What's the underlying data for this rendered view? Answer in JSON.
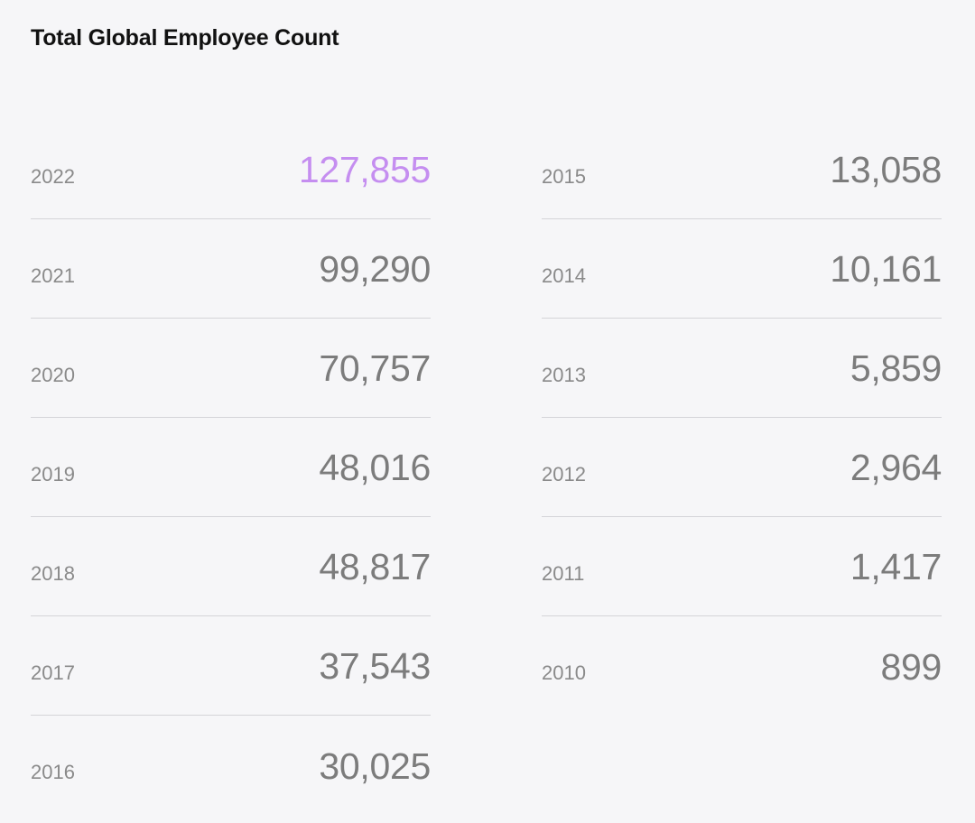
{
  "chart_data": {
    "type": "table",
    "title": "Total Global Employee Count",
    "highlight_color": "#c58ef0",
    "rows": [
      {
        "year": "2022",
        "value": "127,855",
        "highlight": true
      },
      {
        "year": "2021",
        "value": "99,290"
      },
      {
        "year": "2020",
        "value": "70,757"
      },
      {
        "year": "2019",
        "value": "48,016"
      },
      {
        "year": "2018",
        "value": "48,817"
      },
      {
        "year": "2017",
        "value": "37,543"
      },
      {
        "year": "2016",
        "value": "30,025"
      },
      {
        "year": "2015",
        "value": "13,058"
      },
      {
        "year": "2014",
        "value": "10,161"
      },
      {
        "year": "2013",
        "value": "5,859"
      },
      {
        "year": "2012",
        "value": "2,964"
      },
      {
        "year": "2011",
        "value": "1,417"
      },
      {
        "year": "2010",
        "value": "899"
      }
    ]
  }
}
